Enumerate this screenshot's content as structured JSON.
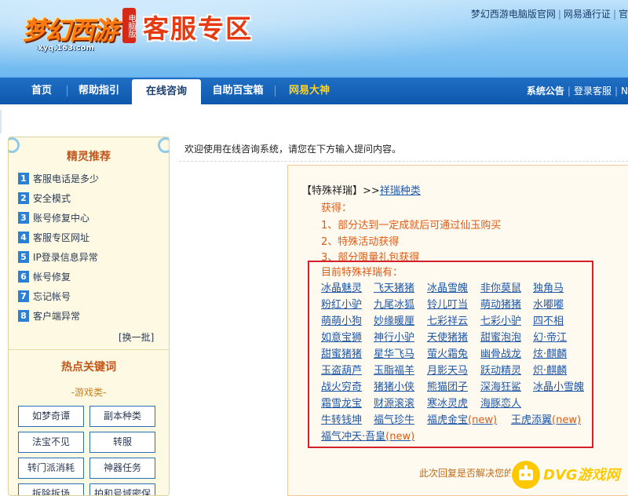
{
  "header": {
    "logo_text": "梦幻西游",
    "logo_sub": "xyq.163.com",
    "badge": "电脑版",
    "zone_title": "客服专区",
    "top_links": [
      "梦幻西游电脑版官网",
      "网易通行证",
      "官"
    ]
  },
  "nav": {
    "items": [
      "首页",
      "帮助指引",
      "在线咨询",
      "自助百宝箱",
      "网易大神"
    ],
    "active_index": 2,
    "right_links": [
      "系统公告",
      "登录客服",
      "N"
    ]
  },
  "sidebar": {
    "rec_title": "精灵推荐",
    "recommendations": [
      {
        "num": "1",
        "label": "客服电话是多少"
      },
      {
        "num": "2",
        "label": "安全模式"
      },
      {
        "num": "3",
        "label": "账号修复中心"
      },
      {
        "num": "4",
        "label": "客服专区网址"
      },
      {
        "num": "5",
        "label": "IP登录信息异常"
      },
      {
        "num": "6",
        "label": "帐号修复"
      },
      {
        "num": "7",
        "label": "忘记帐号"
      },
      {
        "num": "8",
        "label": "客户端异常"
      }
    ],
    "switch_label": "[换一批]",
    "hot_title": "热点关键词",
    "game_cat": "-游戏类-",
    "keywords": [
      "如梦奇谭",
      "副本种类",
      "法宝不见",
      "转服",
      "转门派消耗",
      "神器任务",
      "拆除拆场",
      "拍和号域密保"
    ]
  },
  "main": {
    "welcome": "欢迎使用在线咨询系统，请您在下方输入提问内容。",
    "crumb_prefix": "【特殊祥瑞】>>",
    "crumb_link": "祥瑞种类",
    "acquire_label": "获得：",
    "acquire_items": [
      "1、部分达到一定成就后可通过仙玉购买",
      "2、特殊活动获得",
      "3、部分限量礼包获得"
    ],
    "current_label": "目前特殊祥瑞有：",
    "mounts": [
      [
        "冰晶魅灵",
        "飞天猪猪",
        "冰晶雪魄",
        "非你莫鼠",
        "独角马"
      ],
      [
        "粉红小驴",
        "九尾冰狐",
        "铃儿叮当",
        "萌动猪猪",
        "水嘟嘟"
      ],
      [
        "萌萌小狗",
        "妙缘暖厘",
        "七彩祥云",
        "七彩小驴",
        "四不相"
      ],
      [
        "如意宝狮",
        "神行小驴",
        "天使猪猪",
        "甜蜜泡泡",
        "幻·帝江"
      ],
      [
        "甜蜜猪猪",
        "星华飞马",
        "萤火霜兔",
        "幽骨战龙",
        "炫·麒麟"
      ],
      [
        "玉盗葫芦",
        "玉脂福羊",
        "月影天马",
        "跃动精灵",
        "炽·麒麟"
      ],
      [
        "战火穷奇",
        "猪猪小侠",
        "熊猫团子",
        "深海狂鲨",
        "冰晶小雪魄"
      ],
      [
        "霜雪龙宝",
        "财源滚滚",
        "寒冰灵虎",
        "海豚恋人"
      ],
      [
        "牛转钱坤",
        "福气珍牛",
        "福虎金宝",
        "王虎添翼"
      ],
      [
        "福气冲天·吾皇"
      ]
    ],
    "new_tag": "(new)",
    "tail_text": "此次回复是否解决您的问题"
  },
  "watermark": {
    "text": "DVG游戏网",
    "url": "www.dvg.cn"
  },
  "colors": {
    "nav_bg": "#0e58ad",
    "accent_orange": "#e05a14",
    "link_blue": "#2058a8",
    "highlight_red": "#d4202a"
  }
}
